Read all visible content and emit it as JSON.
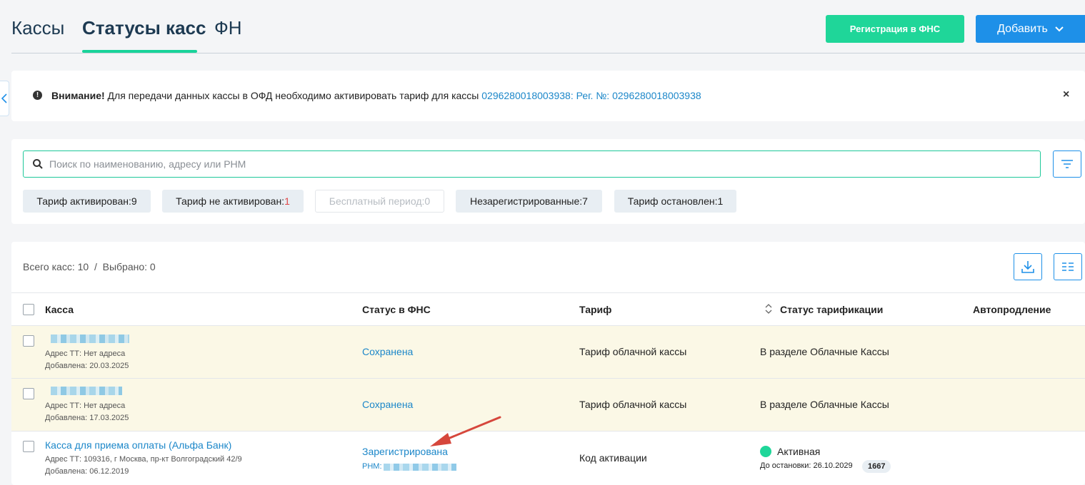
{
  "tabs": [
    {
      "label": "Кассы",
      "active": false
    },
    {
      "label": "Статусы касс",
      "active": true
    },
    {
      "label": "ФН",
      "active": false
    }
  ],
  "buttons": {
    "register_fns": "Регистрация в ФНС",
    "add": "Добавить"
  },
  "alert": {
    "strong": "Внимание!",
    "text": " Для передачи данных кассы в ОФД необходимо активировать тариф для кассы ",
    "link": "0296280018003938: Рег. №: 0296280018003938",
    "close": "×"
  },
  "search": {
    "placeholder": "Поиск по наименованию, адресу или РНМ",
    "value": ""
  },
  "filters": [
    {
      "label": "Тариф активирован: ",
      "count": "9",
      "count_color": "normal",
      "disabled": false
    },
    {
      "label": "Тариф не активирован: ",
      "count": "1",
      "count_color": "#e04848",
      "disabled": false
    },
    {
      "label": "Бесплатный период: ",
      "count": "0",
      "count_color": "normal",
      "disabled": true
    },
    {
      "label": "Незарегистрированные: ",
      "count": "7",
      "count_color": "normal",
      "disabled": false
    },
    {
      "label": "Тариф остановлен: ",
      "count": "1",
      "count_color": "normal",
      "disabled": false
    }
  ],
  "summary": {
    "total_label": "Всего касс: 10",
    "separator": "/",
    "selected_label": "Выбрано: 0"
  },
  "columns": [
    "Касса",
    "Статус в ФНС",
    "Тариф",
    "Статус тарификации",
    "Автопродление"
  ],
  "rows": [
    {
      "name": "",
      "address": "Адрес ТТ: Нет адреса",
      "added": "Добавлена: 20.03.2025",
      "fns_status": "Сохранена",
      "rnm": "",
      "tariff": "Тариф облачной кассы",
      "billing_status": "В разделе Облачные Кассы",
      "highlight": true
    },
    {
      "name": "",
      "address": "Адрес ТТ: Нет адреса",
      "added": "Добавлена: 17.03.2025",
      "fns_status": "Сохранена",
      "rnm": "",
      "tariff": "Тариф облачной кассы",
      "billing_status": "В разделе Облачные Кассы",
      "highlight": true
    },
    {
      "name": "Касса для приема оплаты (Альфа Банк)",
      "address": "Адрес ТТ: 109316, г Москва, пр-кт Волгоградский 42/9",
      "added": "Добавлена: 06.12.2019",
      "fns_status": "Зарегистрирована",
      "rnm": "РНМ:",
      "tariff": "Код активации",
      "billing_status": "Активная",
      "billing_until": "До остановки: 26.10.2029",
      "billing_days": "1667",
      "highlight": false
    }
  ],
  "colors": {
    "accent_green": "#1fd699",
    "accent_blue": "#1e90e8",
    "link": "#1c87c9",
    "row_highlight": "#fbf8e6",
    "annotation_arrow": "#d6473c"
  }
}
